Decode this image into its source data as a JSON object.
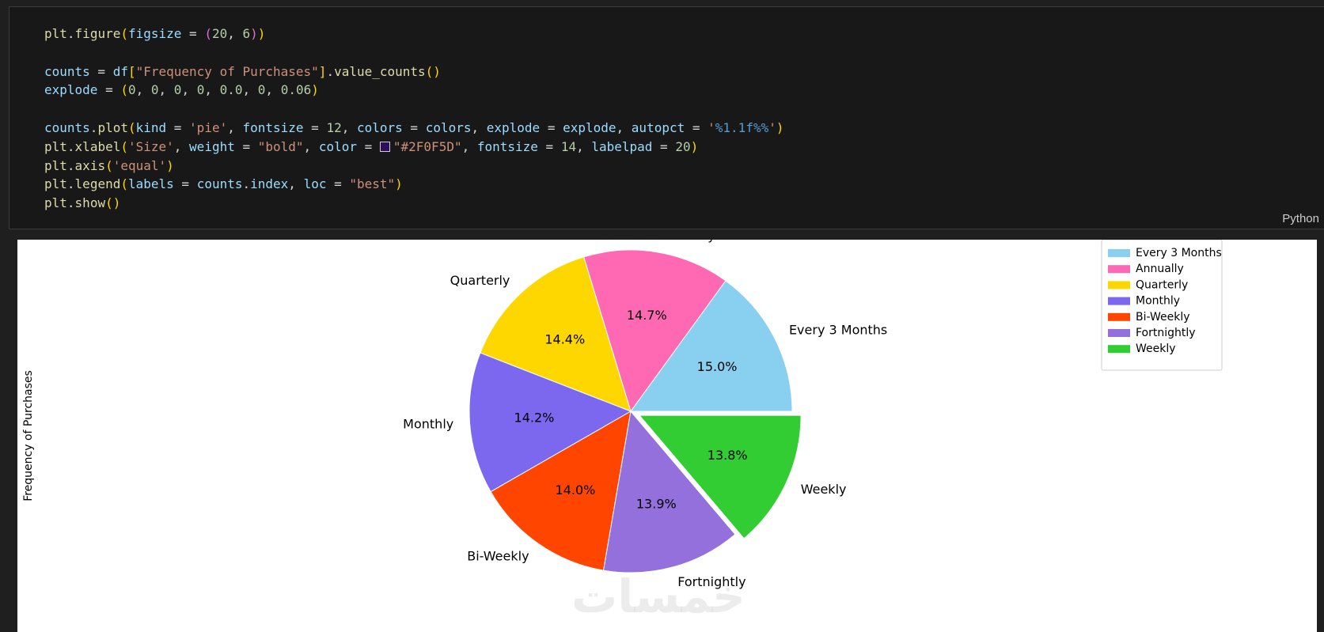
{
  "cell": {
    "language": "Python",
    "code_lines": [
      [
        [
          "fn",
          "plt"
        ],
        [
          "op",
          "."
        ],
        [
          "fn",
          "figure"
        ],
        [
          "b1",
          "("
        ],
        [
          "var",
          "figsize"
        ],
        [
          "op",
          " = "
        ],
        [
          "b2",
          "("
        ],
        [
          "num",
          "20"
        ],
        [
          "op",
          ", "
        ],
        [
          "num",
          "6"
        ],
        [
          "b2",
          ")"
        ],
        [
          "b1",
          ")"
        ]
      ],
      [],
      [
        [
          "var",
          "counts"
        ],
        [
          "op",
          " = "
        ],
        [
          "var",
          "df"
        ],
        [
          "b1",
          "["
        ],
        [
          "str",
          "\"Frequency of Purchases\""
        ],
        [
          "b1",
          "]"
        ],
        [
          "op",
          "."
        ],
        [
          "fn",
          "value_counts"
        ],
        [
          "b1",
          "()"
        ]
      ],
      [
        [
          "var",
          "explode"
        ],
        [
          "op",
          " = "
        ],
        [
          "b1",
          "("
        ],
        [
          "num",
          "0"
        ],
        [
          "op",
          ", "
        ],
        [
          "num",
          "0"
        ],
        [
          "op",
          ", "
        ],
        [
          "num",
          "0"
        ],
        [
          "op",
          ", "
        ],
        [
          "num",
          "0"
        ],
        [
          "op",
          ", "
        ],
        [
          "num",
          "0.0"
        ],
        [
          "op",
          ", "
        ],
        [
          "num",
          "0"
        ],
        [
          "op",
          ", "
        ],
        [
          "num",
          "0.06"
        ],
        [
          "b1",
          ")"
        ]
      ],
      [],
      [
        [
          "var",
          "counts"
        ],
        [
          "op",
          "."
        ],
        [
          "fn",
          "plot"
        ],
        [
          "b1",
          "("
        ],
        [
          "var",
          "kind"
        ],
        [
          "op",
          " = "
        ],
        [
          "str",
          "'pie'"
        ],
        [
          "op",
          ", "
        ],
        [
          "var",
          "fontsize"
        ],
        [
          "op",
          " = "
        ],
        [
          "num",
          "12"
        ],
        [
          "op",
          ", "
        ],
        [
          "var",
          "colors"
        ],
        [
          "op",
          " = "
        ],
        [
          "var",
          "colors"
        ],
        [
          "op",
          ", "
        ],
        [
          "var",
          "explode"
        ],
        [
          "op",
          " = "
        ],
        [
          "var",
          "explode"
        ],
        [
          "op",
          ", "
        ],
        [
          "var",
          "autopct"
        ],
        [
          "op",
          " = "
        ],
        [
          "str",
          "'"
        ],
        [
          "fmt",
          "%1.1f%%"
        ],
        [
          "str",
          "'"
        ],
        [
          "b1",
          ")"
        ]
      ],
      [
        [
          "fn",
          "plt"
        ],
        [
          "op",
          "."
        ],
        [
          "fn",
          "xlabel"
        ],
        [
          "b1",
          "("
        ],
        [
          "str",
          "'Size'"
        ],
        [
          "op",
          ", "
        ],
        [
          "var",
          "weight"
        ],
        [
          "op",
          " = "
        ],
        [
          "str",
          "\"bold\""
        ],
        [
          "op",
          ", "
        ],
        [
          "var",
          "color"
        ],
        [
          "op",
          " = "
        ],
        [
          "swatch",
          "#2F0F5D"
        ],
        [
          "str",
          "\"#2F0F5D\""
        ],
        [
          "op",
          ", "
        ],
        [
          "var",
          "fontsize"
        ],
        [
          "op",
          " = "
        ],
        [
          "num",
          "14"
        ],
        [
          "op",
          ", "
        ],
        [
          "var",
          "labelpad"
        ],
        [
          "op",
          " = "
        ],
        [
          "num",
          "20"
        ],
        [
          "b1",
          ")"
        ]
      ],
      [
        [
          "fn",
          "plt"
        ],
        [
          "op",
          "."
        ],
        [
          "fn",
          "axis"
        ],
        [
          "b1",
          "("
        ],
        [
          "str",
          "'equal'"
        ],
        [
          "b1",
          ")"
        ]
      ],
      [
        [
          "fn",
          "plt"
        ],
        [
          "op",
          "."
        ],
        [
          "fn",
          "legend"
        ],
        [
          "b1",
          "("
        ],
        [
          "var",
          "labels"
        ],
        [
          "op",
          " = "
        ],
        [
          "var",
          "counts"
        ],
        [
          "op",
          "."
        ],
        [
          "var",
          "index"
        ],
        [
          "op",
          ", "
        ],
        [
          "var",
          "loc"
        ],
        [
          "op",
          " = "
        ],
        [
          "str",
          "\"best\""
        ],
        [
          "b1",
          ")"
        ]
      ],
      [
        [
          "fn",
          "plt"
        ],
        [
          "op",
          "."
        ],
        [
          "fn",
          "show"
        ],
        [
          "b1",
          "()"
        ]
      ]
    ]
  },
  "chart_data": {
    "type": "pie",
    "ylabel": "Frequency of Purchases",
    "start_angle_deg": 0,
    "direction": "counterclockwise",
    "legend_position": "top-right",
    "slices": [
      {
        "label": "Every 3 Months",
        "percent": 15.0,
        "pct_text": "15.0%",
        "color": "#89CFF0",
        "explode": 0
      },
      {
        "label": "Annually",
        "percent": 14.7,
        "pct_text": "14.7%",
        "color": "#FF69B4",
        "explode": 0
      },
      {
        "label": "Quarterly",
        "percent": 14.4,
        "pct_text": "14.4%",
        "color": "#FFD700",
        "explode": 0
      },
      {
        "label": "Monthly",
        "percent": 14.2,
        "pct_text": "14.2%",
        "color": "#7B68EE",
        "explode": 0
      },
      {
        "label": "Bi-Weekly",
        "percent": 14.0,
        "pct_text": "14.0%",
        "color": "#FF4500",
        "explode": 0.0
      },
      {
        "label": "Fortnightly",
        "percent": 13.9,
        "pct_text": "13.9%",
        "color": "#9370DB",
        "explode": 0
      },
      {
        "label": "Weekly",
        "percent": 13.8,
        "pct_text": "13.8%",
        "color": "#32CD32",
        "explode": 0.06
      }
    ]
  }
}
